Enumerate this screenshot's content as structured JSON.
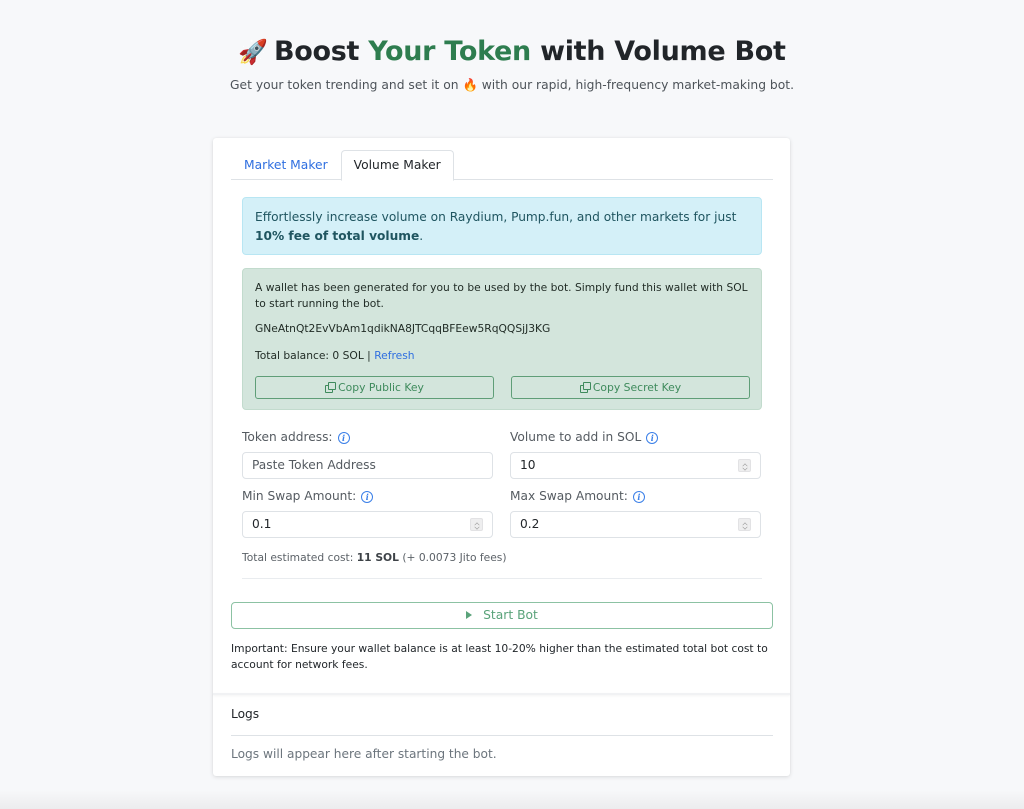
{
  "hero": {
    "rocket_icon": "🚀",
    "title_part1": "Boost",
    "title_accent": "Your Token",
    "title_part2": "with Volume Bot",
    "subtitle_part1": "Get your token trending and set it on",
    "fire_icon": "🔥",
    "subtitle_part2": "with our rapid, high-frequency market-making bot."
  },
  "tabs": [
    {
      "label": "Market Maker",
      "active": false
    },
    {
      "label": "Volume Maker",
      "active": true
    }
  ],
  "info_alert": {
    "text": "Effortlessly increase volume on Raydium, Pump.fun, and other markets for just ",
    "bold": "10% fee of total volume",
    "suffix": "."
  },
  "wallet": {
    "message": "A wallet has been generated for you to be used by the bot. Simply fund this wallet with SOL to start running the bot.",
    "public_key": "GNeAtnQt2EvVbAm1qdikNA8JTCqqBFEew5RqQQSjJ3KG",
    "balance_label": "Total balance: 0 SOL | ",
    "refresh_label": "Refresh",
    "copy_public_label": "Copy Public Key",
    "copy_secret_label": "Copy Secret Key"
  },
  "form": {
    "token_address": {
      "label": "Token address:",
      "placeholder": "Paste Token Address",
      "value": ""
    },
    "volume": {
      "label": "Volume to add in SOL",
      "value": "10"
    },
    "min_swap": {
      "label": "Min Swap Amount:",
      "value": "0.1"
    },
    "max_swap": {
      "label": "Max Swap Amount:",
      "value": "0.2"
    }
  },
  "estimate": {
    "prefix": "Total estimated cost: ",
    "bold": "11 SOL",
    "suffix": " (+ 0.0073 Jito fees)"
  },
  "start_button_label": "Start Bot",
  "important_note": "Important: Ensure your wallet balance is at least 10-20% higher than the estimated total bot cost to account for network fees.",
  "logs": {
    "title": "Logs",
    "empty_message": "Logs will appear here after starting the bot."
  },
  "colors": {
    "accent_green": "#2e7d4f",
    "link_blue": "#2f6fe0",
    "info_bg": "#d4f0f8",
    "wallet_bg": "#d3e5dc",
    "button_green": "#5aa37a"
  }
}
